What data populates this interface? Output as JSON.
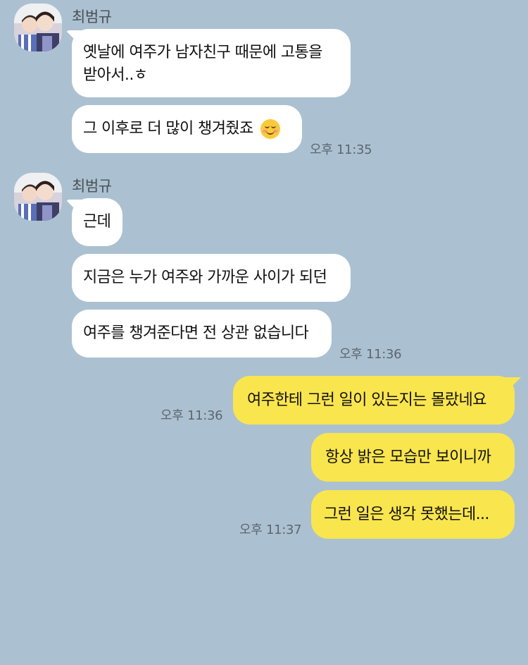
{
  "colors": {
    "background": "#abc1d1",
    "incoming_bubble": "#ffffff",
    "outgoing_bubble": "#f9e54e",
    "timestamp": "#5d6670"
  },
  "groups": [
    {
      "sender": "최범규",
      "messages": [
        {
          "line1": "옛날에 여주가 남자친구 때문에 고통을",
          "line2": "받아서..ㅎ"
        },
        {
          "text": "그 이후로 더 많이 챙겨줬죠",
          "emoji": "smiling-face-icon"
        }
      ],
      "time": "오후 11:35"
    },
    {
      "sender": "최범규",
      "messages": [
        {
          "text": "근데"
        },
        {
          "text": "지금은 누가 여주와 가까운 사이가 되던"
        },
        {
          "text": "여주를 챙겨준다면 전 상관 없습니다"
        }
      ],
      "time": "오후 11:36"
    }
  ],
  "outgoing": [
    {
      "text": "여주한테 그런 일이 있는지는 몰랐네요",
      "time": "오후 11:36"
    },
    {
      "text": "항상 밝은 모습만 보이니까"
    },
    {
      "text": "그런 일은 생각 못했는데...",
      "time": "오후 11:37"
    }
  ]
}
